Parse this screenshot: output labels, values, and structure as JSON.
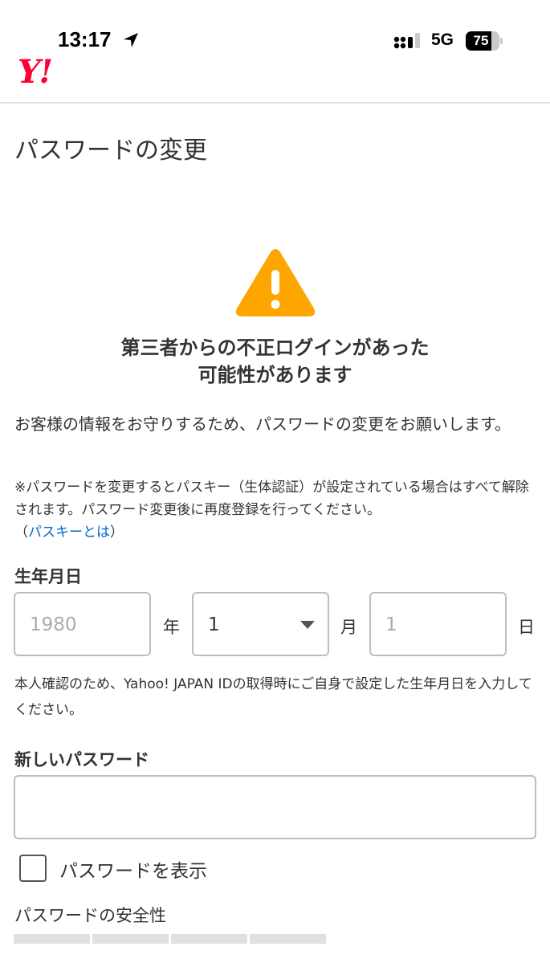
{
  "status_bar": {
    "time": "13:17",
    "network": "5G",
    "battery": "75",
    "battery_level": 0.75,
    "icons": [
      "location-arrow-icon",
      "signal-icon",
      "battery-icon"
    ]
  },
  "header": {
    "logo": "Y!"
  },
  "page": {
    "title": "パスワードの変更"
  },
  "alert": {
    "icon": "warning-icon",
    "icon_color": "#ffa500",
    "line1": "第三者からの不正ログインがあった",
    "line2": "可能性があります"
  },
  "intro": "お客様の情報をお守りするため、パスワードの変更をお願いします。",
  "notice": {
    "text": "※パスワードを変更するとパスキー（生体認証）が設定されている場合はすべて解除されます。パスワード変更後に再度登録を行ってください。",
    "open_paren": "（",
    "link": "パスキーとは",
    "close_paren": "）",
    "link_color": "#0066cc"
  },
  "birthday": {
    "label": "生年月日",
    "year_placeholder": "1980",
    "year_unit": "年",
    "month_value": "1",
    "month_unit": "月",
    "day_placeholder": "1",
    "day_unit": "日",
    "helper": "本人確認のため、Yahoo! JAPAN IDの取得時にご自身で設定した生年月日を入力してください。"
  },
  "password": {
    "label": "新しいパスワード",
    "value": "",
    "show_label": "パスワードを表示",
    "show_checked": false,
    "strength_label": "パスワードの安全性",
    "strength_level": 0
  }
}
